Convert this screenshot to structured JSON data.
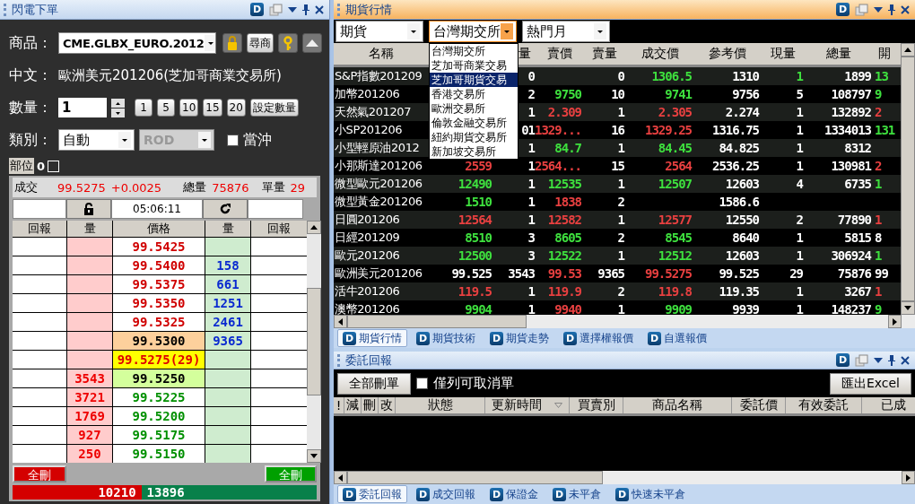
{
  "order_panel": {
    "title": "閃電下單",
    "badge": "D",
    "product": {
      "label": "商品：",
      "value": "CME.GLBX_EURO.2012",
      "search_button": "尋商"
    },
    "chinese": {
      "label": "中文：",
      "value": "歐洲美元201206(芝加哥商業交易所)"
    },
    "quantity": {
      "label": "數量：",
      "value": "1",
      "presets": [
        "1",
        "5",
        "10",
        "15",
        "20"
      ],
      "set_button": "設定數量"
    },
    "type": {
      "label": "類別：",
      "value": "自動",
      "order_type": "ROD",
      "order_type_disabled": true,
      "day_trade": {
        "label": "當沖",
        "checked": false
      }
    },
    "position": {
      "label": "部位",
      "value": "0",
      "checked": false
    },
    "quote": {
      "trade_label": "成交",
      "trade_price": "99.5275",
      "change": "+0.0025",
      "volume_label": "總量",
      "volume": "75876",
      "unit_label": "單量",
      "unit_volume": "29",
      "time": "05:06:11"
    },
    "ladder": {
      "columns": [
        "回報",
        "量",
        "價格",
        "量",
        "回報"
      ],
      "rows": [
        {
          "price": "99.5425",
          "kind": "ask"
        },
        {
          "price": "99.5400",
          "kind": "ask",
          "right_qty": "158"
        },
        {
          "price": "99.5375",
          "kind": "ask",
          "right_qty": "661"
        },
        {
          "price": "99.5350",
          "kind": "ask",
          "right_qty": "1251"
        },
        {
          "price": "99.5325",
          "kind": "ask",
          "right_qty": "2461"
        },
        {
          "price": "99.5300",
          "kind": "best_ask",
          "right_qty": "9365"
        },
        {
          "price": "99.5275(29)",
          "kind": "last"
        },
        {
          "price": "99.5250",
          "kind": "best_bid",
          "left_qty": "3543"
        },
        {
          "price": "99.5225",
          "kind": "bid",
          "left_qty": "3721"
        },
        {
          "price": "99.5200",
          "kind": "bid",
          "left_qty": "1769"
        },
        {
          "price": "99.5175",
          "kind": "bid",
          "left_qty": "927"
        },
        {
          "price": "99.5150",
          "kind": "bid",
          "left_qty": "250"
        }
      ]
    },
    "delete_all_buttons": [
      "全刪",
      "全刪"
    ],
    "totals": {
      "bid": "10210",
      "ask": "13896"
    }
  },
  "quotes_panel": {
    "title": "期貨行情",
    "badge": "D",
    "filters": [
      {
        "value": "期貨",
        "open": false
      },
      {
        "value": "台灣期交所",
        "open": true
      },
      {
        "value": "熱門月",
        "open": false
      }
    ],
    "exchange_options": [
      {
        "label": "台灣期交所",
        "selected": false
      },
      {
        "label": "芝加哥商業交易",
        "selected": false
      },
      {
        "label": "芝加哥期貨交易",
        "selected": true
      },
      {
        "label": "香港交易所",
        "selected": false
      },
      {
        "label": "歐洲交易所",
        "selected": false
      },
      {
        "label": "倫敦金融交易所",
        "selected": false
      },
      {
        "label": "紐約期貨交易所",
        "selected": false
      },
      {
        "label": "新加坡交易所",
        "selected": false
      }
    ],
    "columns": [
      "名稱",
      null,
      "量",
      "賣價",
      "賣量",
      "成交價",
      "參考價",
      "現量",
      "總量",
      "開"
    ],
    "rows": [
      [
        "S&P指數201209",
        null,
        "0",
        null,
        "0",
        {
          "text": "1306.5",
          "color": "#3ee03e"
        },
        "1310",
        {
          "text": "1",
          "color": "#3ee03e"
        },
        "1899",
        {
          "text": "13",
          "color": "#3ee03e"
        }
      ],
      [
        "加幣201206",
        null,
        "2",
        {
          "text": "9750",
          "color": "#3ee03e"
        },
        "10",
        {
          "text": "9741",
          "color": "#3ee03e"
        },
        "9756",
        "5",
        "108797",
        {
          "text": "9",
          "color": "#3ee03e"
        }
      ],
      [
        "天然氣201207",
        null,
        "1",
        {
          "text": "2.309",
          "color": "#e84040"
        },
        "1",
        {
          "text": "2.305",
          "color": "#e84040"
        },
        "2.274",
        "1",
        "132892",
        {
          "text": "2",
          "color": "#e84040"
        }
      ],
      [
        "小SP201206",
        null,
        "01",
        {
          "text": "1329...",
          "color": "#e84040"
        },
        "16",
        {
          "text": "1329.25",
          "color": "#e84040"
        },
        "1316.75",
        "1",
        "1334013",
        {
          "text": "131",
          "color": "#3ee03e"
        }
      ],
      [
        "小型輕原油2012",
        null,
        "1",
        {
          "text": "84.7",
          "color": "#3ee03e"
        },
        "1",
        {
          "text": "84.45",
          "color": "#3ee03e"
        },
        "84.825",
        "1",
        "8312",
        null
      ],
      [
        "小那斯達201206",
        {
          "text": "2559",
          "color": "#e84040"
        },
        "1",
        {
          "text": "2564...",
          "color": "#e84040"
        },
        "15",
        {
          "text": "2564",
          "color": "#e84040"
        },
        "2536.25",
        "1",
        "130981",
        {
          "text": "2",
          "color": "#e84040"
        }
      ],
      [
        "微型歐元201206",
        {
          "text": "12490",
          "color": "#3ee03e"
        },
        "1",
        {
          "text": "12535",
          "color": "#3ee03e"
        },
        "1",
        {
          "text": "12507",
          "color": "#3ee03e"
        },
        "12603",
        "4",
        "6735",
        {
          "text": "1",
          "color": "#3ee03e"
        }
      ],
      [
        "微型黃金201206",
        {
          "text": "1510",
          "color": "#3ee03e"
        },
        "1",
        {
          "text": "1838",
          "color": "#e84040"
        },
        "2",
        null,
        "1586.6",
        null,
        null,
        null
      ],
      [
        "日圓201206",
        {
          "text": "12564",
          "color": "#e84040"
        },
        "1",
        {
          "text": "12582",
          "color": "#e84040"
        },
        "1",
        {
          "text": "12577",
          "color": "#e84040"
        },
        "12550",
        "2",
        "77890",
        {
          "text": "1",
          "color": "#e84040"
        }
      ],
      [
        "日經201209",
        {
          "text": "8510",
          "color": "#3ee03e"
        },
        "3",
        {
          "text": "8605",
          "color": "#3ee03e"
        },
        "2",
        {
          "text": "8545",
          "color": "#3ee03e"
        },
        "8640",
        "1",
        "5815",
        "8"
      ],
      [
        "歐元201206",
        {
          "text": "12500",
          "color": "#3ee03e"
        },
        "3",
        {
          "text": "12522",
          "color": "#3ee03e"
        },
        "1",
        {
          "text": "12512",
          "color": "#3ee03e"
        },
        "12603",
        "1",
        "306924",
        {
          "text": "1",
          "color": "#3ee03e"
        }
      ],
      [
        "歐洲美元201206",
        "99.525",
        "3543",
        {
          "text": "99.53",
          "color": "#e84040"
        },
        "9365",
        {
          "text": "99.5275",
          "color": "#e84040"
        },
        "99.525",
        "29",
        "75876",
        "99"
      ],
      [
        "活牛201206",
        {
          "text": "119.5",
          "color": "#e84040"
        },
        "1",
        {
          "text": "119.9",
          "color": "#e84040"
        },
        "2",
        {
          "text": "119.8",
          "color": "#e84040"
        },
        "119.35",
        "1",
        "3267",
        {
          "text": "1",
          "color": "#e84040"
        }
      ],
      [
        "澳幣201206",
        {
          "text": "9904",
          "color": "#3ee03e"
        },
        "1",
        {
          "text": "9940",
          "color": "#e84040"
        },
        "1",
        {
          "text": "9909",
          "color": "#3ee03e"
        },
        "9939",
        "1",
        "148237",
        {
          "text": "9",
          "color": "#3ee03e"
        }
      ]
    ]
  },
  "quote_tabs": [
    {
      "badge": "D",
      "label": "期貨行情",
      "selected": true
    },
    {
      "badge": "D",
      "label": "期貨技術",
      "selected": false
    },
    {
      "badge": "D",
      "label": "期貨走勢",
      "selected": false
    },
    {
      "badge": "D",
      "label": "選擇權報價",
      "selected": false
    },
    {
      "badge": "D",
      "label": "自選報價",
      "selected": false
    }
  ],
  "orders_panel": {
    "title": "委託回報",
    "badge": "D",
    "delete_all": "全部刪單",
    "cancellable_only": {
      "label": "僅列可取消單",
      "checked": false
    },
    "export": "匯出Excel",
    "columns": [
      {
        "label": "!",
        "sorted": false
      },
      {
        "label": "減",
        "sorted": false
      },
      {
        "label": "刪",
        "sorted": false
      },
      {
        "label": "改",
        "sorted": false
      },
      {
        "label": "狀態",
        "sorted": false
      },
      {
        "label": "更新時間",
        "sorted": true
      },
      {
        "label": "買賣別",
        "sorted": false
      },
      {
        "label": "商品名稱",
        "sorted": false
      },
      {
        "label": "委託價",
        "sorted": false
      },
      {
        "label": "有效委託",
        "sorted": false
      },
      {
        "label": "已成",
        "sorted": false
      }
    ]
  },
  "order_tabs": [
    {
      "badge": "D",
      "label": "委託回報",
      "selected": true
    },
    {
      "badge": "D",
      "label": "成交回報",
      "selected": false
    },
    {
      "badge": "D",
      "label": "保證金",
      "selected": false
    },
    {
      "badge": "D",
      "label": "未平倉",
      "selected": false
    },
    {
      "badge": "D",
      "label": "快速未平倉",
      "selected": false
    }
  ]
}
